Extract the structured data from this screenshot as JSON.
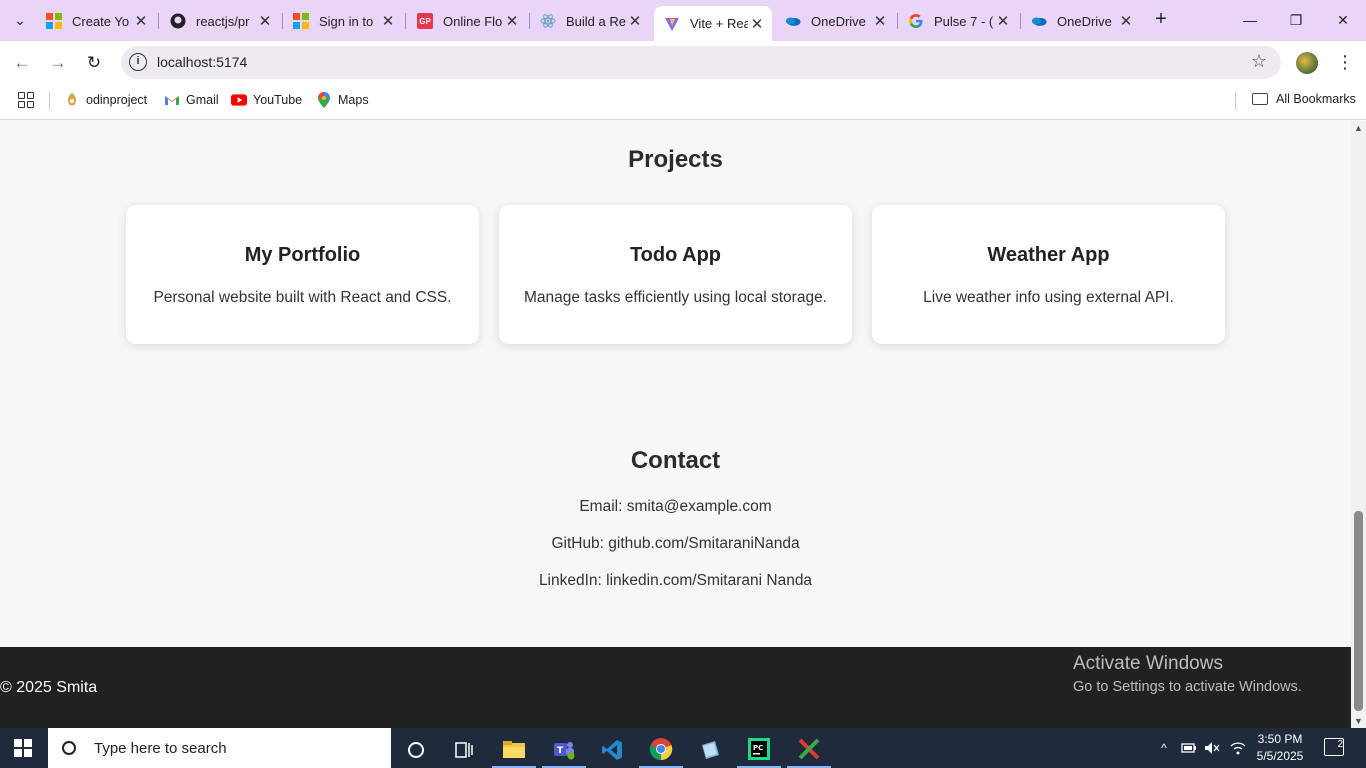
{
  "browser": {
    "tabs": [
      {
        "label": "Create Yo",
        "icon": "microsoft-icon"
      },
      {
        "label": "reactjs/pr",
        "icon": "github-icon"
      },
      {
        "label": "Sign in to",
        "icon": "microsoft-icon"
      },
      {
        "label": "Online Flo",
        "icon": "online-flowchart-icon"
      },
      {
        "label": "Build a Re",
        "icon": "react-icon"
      },
      {
        "label": "Vite + Rea",
        "icon": "vite-icon",
        "active": true
      },
      {
        "label": "OneDrive",
        "icon": "onedrive-icon"
      },
      {
        "label": "Pulse 7 - (",
        "icon": "google-icon"
      },
      {
        "label": "OneDrive",
        "icon": "onedrive-icon"
      }
    ],
    "url": "localhost:5174",
    "bookmarks": [
      {
        "label": "odinproject",
        "icon": "odin-icon"
      },
      {
        "label": "Gmail",
        "icon": "gmail-icon"
      },
      {
        "label": "YouTube",
        "icon": "youtube-icon"
      },
      {
        "label": "Maps",
        "icon": "maps-icon"
      }
    ],
    "all_bookmarks_label": "All Bookmarks"
  },
  "page": {
    "projects_title": "Projects",
    "projects": [
      {
        "title": "My Portfolio",
        "description": "Personal website built with React and CSS."
      },
      {
        "title": "Todo App",
        "description": "Manage tasks efficiently using local storage."
      },
      {
        "title": "Weather App",
        "description": "Live weather info using external API."
      }
    ],
    "contact_title": "Contact",
    "contact": {
      "email": "Email: smita@example.com",
      "github": "GitHub: github.com/SmitaraniNanda",
      "linkedin": "LinkedIn: linkedin.com/Smitarani Nanda"
    },
    "footer": {
      "copyright": "© 2025 Smita"
    },
    "watermark": {
      "line1": "Activate Windows",
      "line2": "Go to Settings to activate Windows."
    }
  },
  "taskbar": {
    "search_placeholder": "Type here to search",
    "time": "3:50 PM",
    "date": "5/5/2025",
    "notification_count": "2"
  }
}
